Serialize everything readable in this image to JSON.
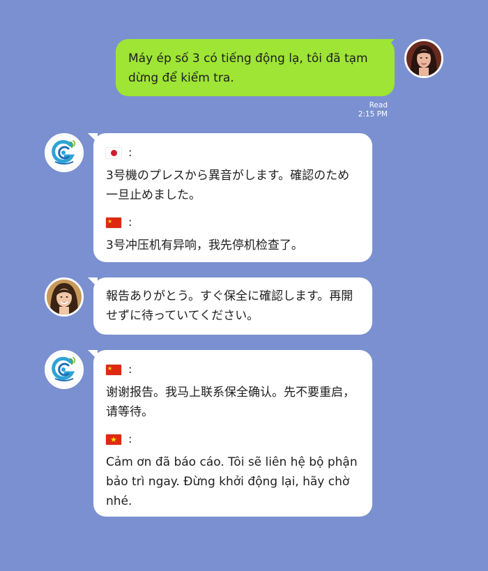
{
  "chat": {
    "messages": [
      {
        "sender": "user",
        "text": "Máy ép số 3 có tiếng động lạ, tôi đã tạm dừng để kiểm tra.",
        "status": "Read",
        "time": "2:15 PM"
      },
      {
        "sender": "bot",
        "translations": [
          {
            "flag": "jp-flag",
            "colon": ":",
            "text": "3号機のプレスから異音がします。確認のため一旦止めました。"
          },
          {
            "flag": "cn-flag",
            "colon": ":",
            "text": "3号冲压机有异响，我先停机检查了。"
          }
        ]
      },
      {
        "sender": "operator",
        "text": "報告ありがとう。すぐ保全に確認します。再開せずに待っていてください。"
      },
      {
        "sender": "bot",
        "translations": [
          {
            "flag": "cn-flag",
            "colon": ":",
            "text": "谢谢报告。我马上联系保全确认。先不要重启，请等待。"
          },
          {
            "flag": "vn-flag",
            "colon": ":",
            "text": "Cảm ơn đã báo cáo. Tôi sẽ liên hệ bộ phận bảo trì ngay. Đừng khởi động lại, hãy chờ nhé."
          }
        ]
      }
    ]
  },
  "colors": {
    "background": "#7b90d0",
    "user_bubble": "#9ee535",
    "other_bubble": "#ffffff"
  }
}
